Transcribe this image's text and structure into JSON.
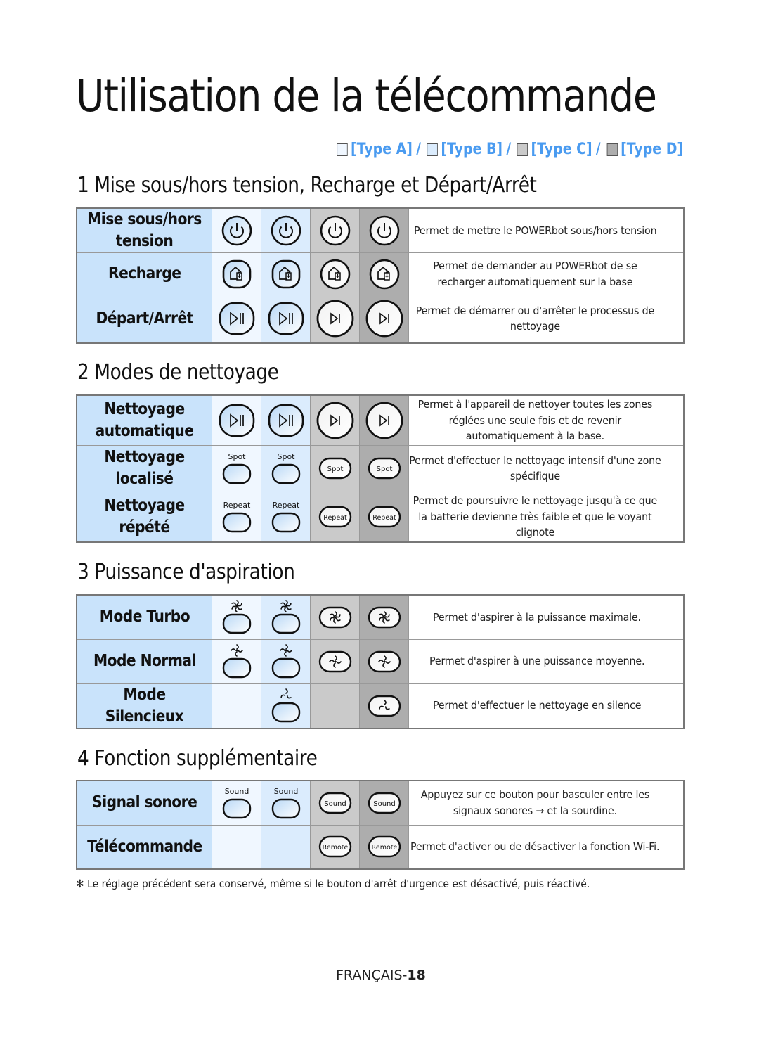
{
  "page_title": "Utilisation de la télécommande",
  "legend": {
    "items": [
      {
        "label": "[Type A]",
        "color": "#f0f7ff"
      },
      {
        "label": "[Type B]",
        "color": "#dbecfd"
      },
      {
        "label": "[Type C]",
        "color": "#cacaca"
      },
      {
        "label": "[Type D]",
        "color": "#adadad"
      }
    ],
    "separator": "/",
    "text_color": "#4a9bf0"
  },
  "sections": [
    {
      "title": "1 Mise sous/hors tension, Recharge et Départ/Arrêt",
      "rows": [
        {
          "label": "Mise sous/hors tension",
          "icon": "power-icon",
          "desc": "Permet de mettre le POWERbot sous/hors tension"
        },
        {
          "label": "Recharge",
          "icon": "home-battery-icon",
          "desc": "Permet de demander au POWERbot de se recharger automatiquement sur la base"
        },
        {
          "label": "Départ/Arrêt",
          "icon": "play-pause-icon",
          "desc": "Permet de démarrer ou d'arrêter le processus de nettoyage"
        }
      ]
    },
    {
      "title": "2 Modes de nettoyage",
      "rows": [
        {
          "label": "Nettoyage automatique",
          "icon": "play-pause-icon",
          "desc": "Permet à l'appareil de nettoyer toutes les zones réglées une seule fois et de revenir automatiquement à la base."
        },
        {
          "label": "Nettoyage localisé",
          "icon": "spot-button",
          "button_text": "Spot",
          "desc": "Permet d'effectuer le nettoyage intensif d'une zone spécifique"
        },
        {
          "label": "Nettoyage répété",
          "icon": "repeat-button",
          "button_text": "Repeat",
          "desc": "Permet de poursuivre le nettoyage jusqu'à ce que la batterie devienne très faible et que le voyant clignote"
        }
      ]
    },
    {
      "title": "3 Puissance d'aspiration",
      "rows": [
        {
          "label": "Mode Turbo",
          "icon": "fan-turbo-icon",
          "desc": "Permet d'aspirer à la puissance maximale."
        },
        {
          "label": "Mode Normal",
          "icon": "fan-normal-icon",
          "desc": "Permet d'aspirer à une puissance moyenne."
        },
        {
          "label": "Mode Silencieux",
          "icon": "fan-silent-icon",
          "desc": "Permet d'effectuer le nettoyage en silence"
        }
      ]
    },
    {
      "title": "4 Fonction supplémentaire",
      "rows": [
        {
          "label": "Signal sonore",
          "icon": "sound-button",
          "button_text": "Sound",
          "desc": "Appuyez sur ce bouton pour basculer entre les signaux sonores → et la sourdine."
        },
        {
          "label": "Télécommande",
          "icon": "remote-button",
          "button_text": "Remote",
          "desc": "Permet d'activer ou de désactiver la fonction Wi-Fi."
        }
      ]
    }
  ],
  "footnote": "✻ Le réglage précédent sera conservé, même si le bouton d'arrêt d'urgence est désactivé, puis réactivé.",
  "page_number": {
    "prefix": "FRANÇAIS-",
    "number": "18"
  }
}
